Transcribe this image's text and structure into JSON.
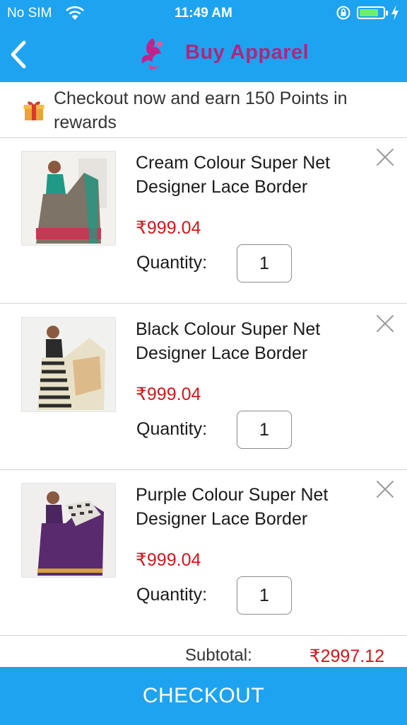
{
  "status_bar": {
    "carrier": "No SIM",
    "time": "11:49 AM"
  },
  "header": {
    "title": "Buy Apparel",
    "back_icon": "chevron-left-icon",
    "logo_icon": "flourish-logo-icon",
    "background_color": "#1ea3f0",
    "title_color": "#b0267e"
  },
  "rewards_banner": {
    "icon": "gift-icon",
    "text": "Checkout now and earn 150 Points in rewards"
  },
  "cart": {
    "quantity_label": "Quantity:",
    "items": [
      {
        "title": "Cream Colour Super Net Designer Lace Border",
        "price": "₹999.04",
        "quantity": "1",
        "saree_color": "#1f9a86"
      },
      {
        "title": "Black Colour Super Net Designer Lace Border",
        "price": "₹999.04",
        "quantity": "1",
        "saree_color": "#2b2b2b"
      },
      {
        "title": "Purple Colour Super Net Designer Lace Border",
        "price": "₹999.04",
        "quantity": "1",
        "saree_color": "#5a2a6e"
      }
    ]
  },
  "summary": {
    "subtotal_label": "Subtotal:",
    "subtotal_value": "₹2997.12",
    "price_color": "#d0171b"
  },
  "checkout_button": {
    "label": "CHECKOUT"
  }
}
